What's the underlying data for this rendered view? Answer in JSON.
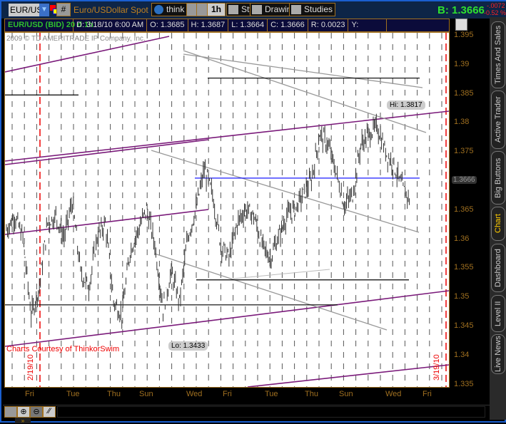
{
  "toolbar": {
    "symbol": "EUR/USD",
    "description": "Euro/USDollar Spot",
    "hash": "#",
    "thinkai": "think A.I.",
    "timeframe": "1h",
    "style": "Style",
    "drawings": "Drawings",
    "studies": "Studies",
    "bid": "B: 1.3666",
    "change": "-.0072",
    "change_pct": "-0.52 %"
  },
  "info": {
    "title": "EUR/USD (BID) 20 d 1h",
    "date": "D: 3/18/10 6:00 AM",
    "open": "O: 1.3685",
    "high": "H: 1.3687",
    "low": "L: 1.3664",
    "close": "C: 1.3666",
    "range": "R: 0.0023",
    "y": "Y:"
  },
  "tabs": [
    "Times And Sales",
    "Active Trader",
    "Big Buttons",
    "Chart",
    "Dashboard",
    "Level II",
    "Live News"
  ],
  "chart_data": {
    "type": "bar",
    "title": "EUR/USD (BID) 20 d 1h",
    "copyright": "2009 © TD AMERITRADE IP Company, Inc.",
    "watermark": "Charts Courtesy of ThinkorSwim",
    "ylim": [
      1.3345,
      1.3955
    ],
    "yticks": [
      "1.395",
      "1.39",
      "1.385",
      "1.38",
      "1.375",
      "1.37",
      "1.365",
      "1.36",
      "1.355",
      "1.35",
      "1.345",
      "1.34",
      "1.335"
    ],
    "xticks": [
      "Fri",
      "Tue",
      "Thu",
      "Sun",
      "Wed",
      "Fri",
      "Tue",
      "Thu",
      "Sun",
      "Wed",
      "Fri"
    ],
    "date_markers": [
      "2/19/10",
      "3/19/10"
    ],
    "last_price": "1.3666",
    "hi_label": "Hi: 1.3817",
    "lo_label": "Lo: 1.3433",
    "closes": [
      1.3616,
      1.364,
      1.3603,
      1.3469,
      1.3518,
      1.3628,
      1.364,
      1.3603,
      1.3665,
      1.3542,
      1.3518,
      1.3603,
      1.3628,
      1.3493,
      1.3469,
      1.3579,
      1.3616,
      1.3652,
      1.3591,
      1.3481,
      1.3542,
      1.3493,
      1.3603,
      1.3652,
      1.372,
      1.3677,
      1.3591,
      1.3567,
      1.3628,
      1.3652,
      1.364,
      1.3591,
      1.3567,
      1.3603,
      1.364,
      1.3652,
      1.3677,
      1.3701,
      1.3781,
      1.3763,
      1.3714,
      1.3658,
      1.3677,
      1.3763,
      1.3781,
      1.3793,
      1.375,
      1.3726,
      1.3689,
      1.3666
    ],
    "levels": [
      1.3877,
      1.3848,
      1.3705,
      1.353,
      1.3487
    ]
  },
  "bottom": {
    "expand": "»"
  }
}
